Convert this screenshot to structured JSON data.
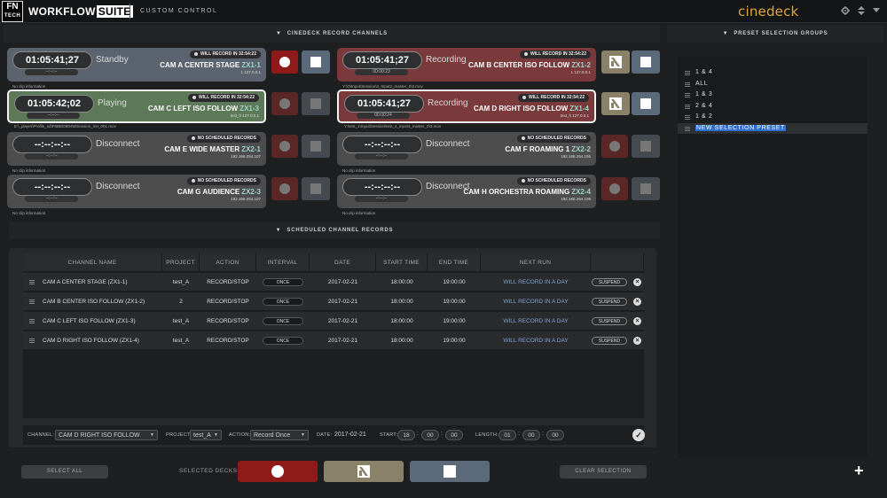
{
  "header": {
    "logo_top": "FN",
    "logo_bottom": "TECH",
    "brand": "WORKFLOW",
    "brand_suite": "SUITE",
    "subtitle": "CUSTOM CONTROL",
    "product": "cinedeck"
  },
  "record_section_title": "CINEDECK RECORD CHANNELS",
  "scheduled_section_title": "SCHEDULED CHANNEL RECORDS",
  "preset_section_title": "PRESET SELECTION GROUPS",
  "channels": [
    {
      "timecode": "01:05:41;27",
      "sub": "--:--:--",
      "state": "Standby",
      "sched": "WILL RECORD IN  32:54:22",
      "name": "CAM A CENTER STAGE",
      "zx": "ZX1-1",
      "ip": "1   127.0.0.1",
      "path": "No clip information"
    },
    {
      "timecode": "01:05:41;27",
      "sub": "00:00:23",
      "state": "Recording",
      "sched": "WILL RECORD IN  32:54:22",
      "name": "CAM B CENTER ISO FOLLOW",
      "zx": "ZX1-2",
      "ip": "1   127.0.0.1",
      "path": "Y:\\O\\Input\\Session\\3_Input2_master_0\\3.mov"
    },
    {
      "timecode": "01:05:42;02",
      "sub": "--:--:--",
      "state": "Playing",
      "sched": "WILL RECORD IN  32:54:22",
      "name": "CAM C LEFT ISO FOLLOW",
      "zx": "ZX1-3",
      "ip": "test_h   127.0.0.1",
      "path": "E:\\_player\\Profile_sd\\F6BB\\0994\\6\\Session_SH_001.mov"
    },
    {
      "timecode": "01:05:41;27",
      "sub": "00:00:24",
      "state": "Recording",
      "sched": "WILL RECORD IN  32:54:22",
      "name": "CAM D RIGHT ISO FOLLOW",
      "zx": "ZX1-4",
      "ip": "test_h   127.0.0.1",
      "path": "Y:\\test_1\\Input\\Session\\test_4_input4_master_0\\3.mov"
    },
    {
      "timecode": "--:--:--:--",
      "sub": "--:--:--",
      "state": "Disconnect",
      "sched": "NO SCHEDULED RECORDS",
      "name": "CAM E WIDE MASTER",
      "zx": "ZX2-1",
      "ip": "192.168.254.107",
      "path": "No clip information"
    },
    {
      "timecode": "--:--:--:--",
      "sub": "--:--:--",
      "state": "Disconnect",
      "sched": "NO SCHEDULED RECORDS",
      "name": "CAM F ROAMING 1",
      "zx": "ZX2-2",
      "ip": "192.168.254.106",
      "path": "No clip information"
    },
    {
      "timecode": "--:--:--:--",
      "sub": "--:--:--",
      "state": "Disconnect",
      "sched": "NO SCHEDULED RECORDS",
      "name": "CAM G AUDIENCE",
      "zx": "ZX2-3",
      "ip": "192.168.254.107",
      "path": "No clip information"
    },
    {
      "timecode": "--:--:--:--",
      "sub": "--:--:--",
      "state": "Disconnect",
      "sched": "NO SCHEDULED RECORDS",
      "name": "CAM H ORCHESTRA ROAMING",
      "zx": "ZX2-4",
      "ip": "192.168.254.109",
      "path": "No clip information"
    }
  ],
  "table": {
    "headers": [
      "CHANNEL NAME",
      "PROJECT",
      "ACTION",
      "INTERVAL",
      "DATE",
      "START TIME",
      "END TIME",
      "NEXT RUN"
    ],
    "rows": [
      {
        "channel": "CAM A CENTER STAGE (ZX1-1)",
        "project": "test_A",
        "action": "RECORD/STOP",
        "interval": "ONCE",
        "date": "2017-02-21",
        "start": "18:00:00",
        "end": "19:00:00",
        "next": "WILL RECORD IN A DAY",
        "suspend": "SUSPEND"
      },
      {
        "channel": "CAM B CENTER ISO FOLLOW (ZX1-2)",
        "project": "2",
        "action": "RECORD/STOP",
        "interval": "ONCE",
        "date": "2017-02-21",
        "start": "18:00:00",
        "end": "19:00:00",
        "next": "WILL RECORD IN A DAY",
        "suspend": "SUSPEND"
      },
      {
        "channel": "CAM C LEFT ISO FOLLOW (ZX1-3)",
        "project": "test_A",
        "action": "RECORD/STOP",
        "interval": "ONCE",
        "date": "2017-02-21",
        "start": "18:00:00",
        "end": "19:00:00",
        "next": "WILL RECORD IN A DAY",
        "suspend": "SUSPEND"
      },
      {
        "channel": "CAM D RIGHT ISO FOLLOW (ZX1-4)",
        "project": "test_A",
        "action": "RECORD/STOP",
        "interval": "ONCE",
        "date": "2017-02-21",
        "start": "18:00:00",
        "end": "19:00:00",
        "next": "WILL RECORD IN A DAY",
        "suspend": "SUSPEND"
      }
    ]
  },
  "form": {
    "channel_label": "CHANNEL:",
    "channel_value": "CAM D RIGHT ISO FOLLOW",
    "project_label": "PROJECT:",
    "project_value": "test_A",
    "action_label": "ACTION:",
    "action_value": "Record Once",
    "date_label": "DATE:",
    "date_value": "2017-02-21",
    "start_label": "START:",
    "start_h": "18",
    "start_m": "00",
    "start_s": "00",
    "length_label": "LENGTH:",
    "len_h": "01",
    "len_m": "00",
    "len_s": "00"
  },
  "bottom": {
    "select_all": "SELECT ALL",
    "selected_decks": "SELECTED DECKS:",
    "clear_selection": "CLEAR SELECTION"
  },
  "presets": [
    "1 & 4",
    "ALL",
    "1 & 3",
    "2 & 4",
    "1 & 2",
    "NEW SELECTION PRESET"
  ],
  "colors": {
    "accent": "#e0a632",
    "record": "#8e1a1a",
    "stop": "#5b6a7a",
    "playing": "#5c7a57",
    "recording_card": "#7a3a3b"
  }
}
